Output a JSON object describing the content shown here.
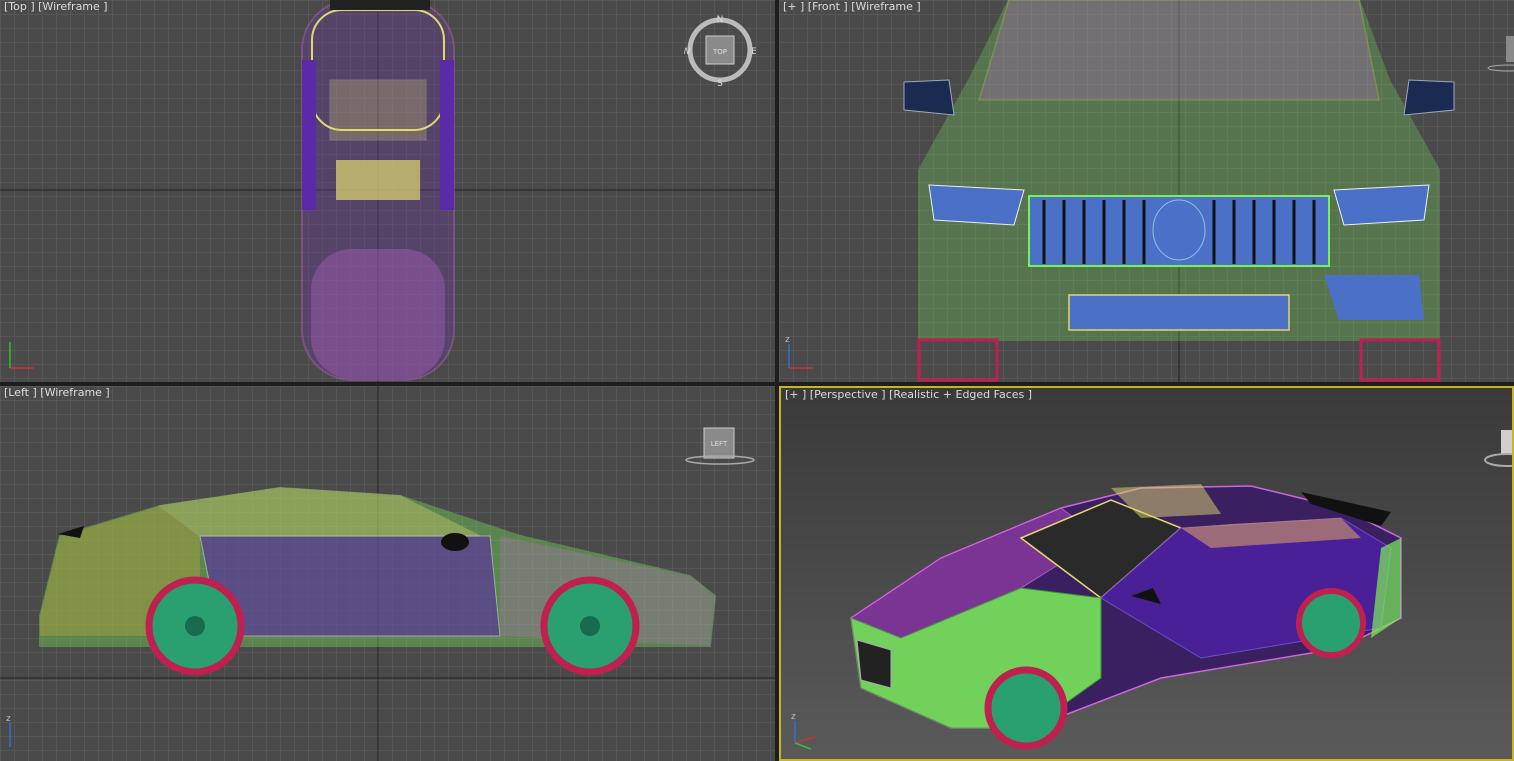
{
  "viewports": {
    "top": {
      "label": "[Top ] [Wireframe ]"
    },
    "front": {
      "label": "[+ ] [Front ] [Wireframe ]"
    },
    "left": {
      "label": "[Left ] [Wireframe ]"
    },
    "perspective": {
      "label": "[+ ] [Perspective ] [Realistic + Edged Faces ]"
    }
  },
  "viewcube": {
    "top_face": "TOP",
    "left_face": "LEFT",
    "compass": {
      "n": "N",
      "s": "S",
      "e": "E",
      "w": "W"
    }
  },
  "axis_labels": {
    "x": "x",
    "y": "y",
    "z": "z"
  },
  "colors": {
    "active_border": "#c8b428",
    "wire_green": "#7cf05a",
    "wire_purple": "#cc66e0",
    "wire_yellow": "#e0d870",
    "wire_blue": "#4a70c8",
    "wire_violet": "#5a2aa8",
    "tire_red": "#c02050",
    "rim_green": "#2aa070"
  }
}
